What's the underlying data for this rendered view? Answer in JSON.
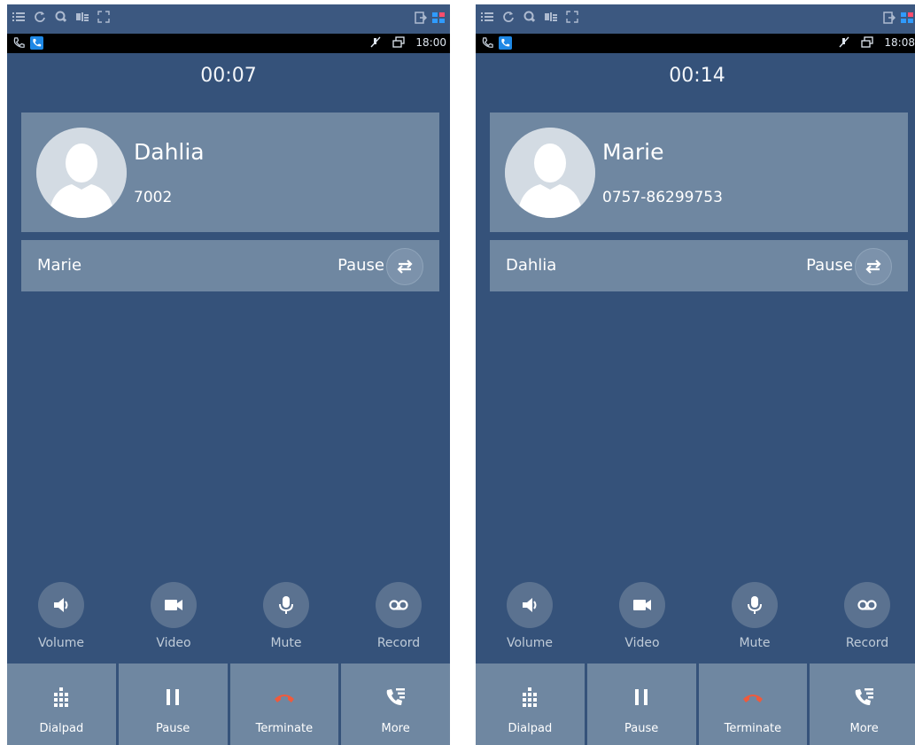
{
  "left_screen": {
    "clock": "18:00",
    "timer": "00:07",
    "caller": {
      "name": "Dahlia",
      "number": "7002"
    },
    "held": {
      "name": "Marie",
      "status": "Pause"
    }
  },
  "right_screen": {
    "clock": "18:08",
    "timer": "00:14",
    "caller": {
      "name": "Marie",
      "number": "0757-86299753"
    },
    "held": {
      "name": "Dahlia",
      "status": "Pause"
    }
  },
  "actions": {
    "volume": "Volume",
    "video": "Video",
    "mute": "Mute",
    "record": "Record"
  },
  "tabs": {
    "dialpad": "Dialpad",
    "pause": "Pause",
    "terminate": "Terminate",
    "more": "More"
  },
  "colors": {
    "background": "#35527a",
    "card": "#6f87a1",
    "action_circle": "#5b7290",
    "terminate_red": "#ef5a3c",
    "statusbar": "#000000"
  },
  "icons": {
    "topbar": [
      "menu-icon",
      "refresh-icon",
      "zoom-icon",
      "signal-icon",
      "expand-icon"
    ],
    "topbar_right": [
      "exit-icon",
      "grid-icon"
    ],
    "status": [
      "phone-icon",
      "active-call-icon",
      "mute-off-icon",
      "window-icon"
    ],
    "actions": [
      "volume-icon",
      "video-icon",
      "mic-icon",
      "voicemail-icon"
    ],
    "tabs": [
      "dialpad-icon",
      "pause-icon",
      "hangup-icon",
      "more-icon"
    ],
    "swap": "swap-icon"
  }
}
